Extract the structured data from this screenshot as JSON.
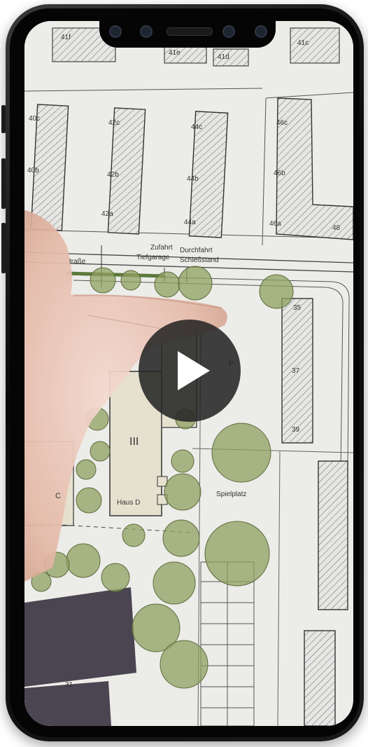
{
  "video": {
    "play_label": "Play video"
  },
  "plan": {
    "street_label": "traße",
    "zufahrt": "Zufahrt",
    "tiefgarage": "Tiefgarage",
    "durchfahrt": "Durchfahrt",
    "schiessstand": "Schießstand",
    "spielplatz": "Spielplatz",
    "haus_d": "Haus D",
    "haus_c": "C",
    "floors_d": "III",
    "building_numbers": [
      "41f",
      "41e",
      "41d",
      "41c",
      "40c",
      "40b",
      "42c",
      "42b",
      "42a",
      "44c",
      "44b",
      "44a",
      "46c",
      "46b",
      "46a",
      "48",
      "35",
      "37",
      "39",
      "31",
      "P"
    ]
  },
  "colors": {
    "paper": "#ececea",
    "tree_fill": "#8fa060",
    "building_hatch": "#555555",
    "dark_building": "#4a4550",
    "frame": "#0a0a0a"
  }
}
